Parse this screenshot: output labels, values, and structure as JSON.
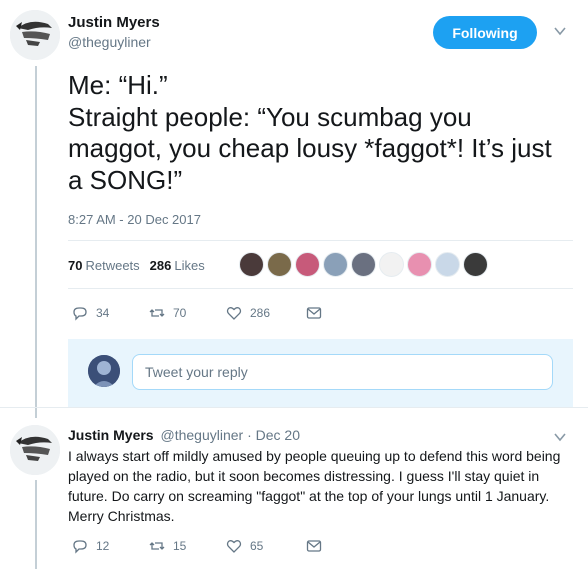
{
  "main_tweet": {
    "author_name": "Justin Myers",
    "author_handle": "@theguyliner",
    "follow_label": "Following",
    "text": "Me: “Hi.”\nStraight people: “You scumbag you maggot, you cheap lousy *faggot*! It’s just a SONG!”",
    "timestamp": "8:27 AM - 20 Dec 2017",
    "retweets_count": "70",
    "retweets_label": "Retweets",
    "likes_count": "286",
    "likes_label": "Likes",
    "actions": {
      "reply_count": "34",
      "retweet_count": "70",
      "like_count": "286"
    }
  },
  "reply_composer": {
    "placeholder": "Tweet your reply"
  },
  "reply_tweet": {
    "author_name": "Justin Myers",
    "author_handle": "@theguyliner",
    "date": "· Dec 20",
    "text": "I always start off mildly amused by people queuing up to defend this word being played on the radio, but it soon becomes distressing. I guess I'll stay quiet in future. Do carry on screaming \"faggot\" at the top of your lungs until 1 January. Merry Christmas.",
    "actions": {
      "reply_count": "12",
      "retweet_count": "15",
      "like_count": "65"
    }
  },
  "colors": {
    "accent": "#1da1f2",
    "muted_text": "#657786",
    "primary_text": "#14171a",
    "reply_box_bg": "#e8f5fd"
  }
}
